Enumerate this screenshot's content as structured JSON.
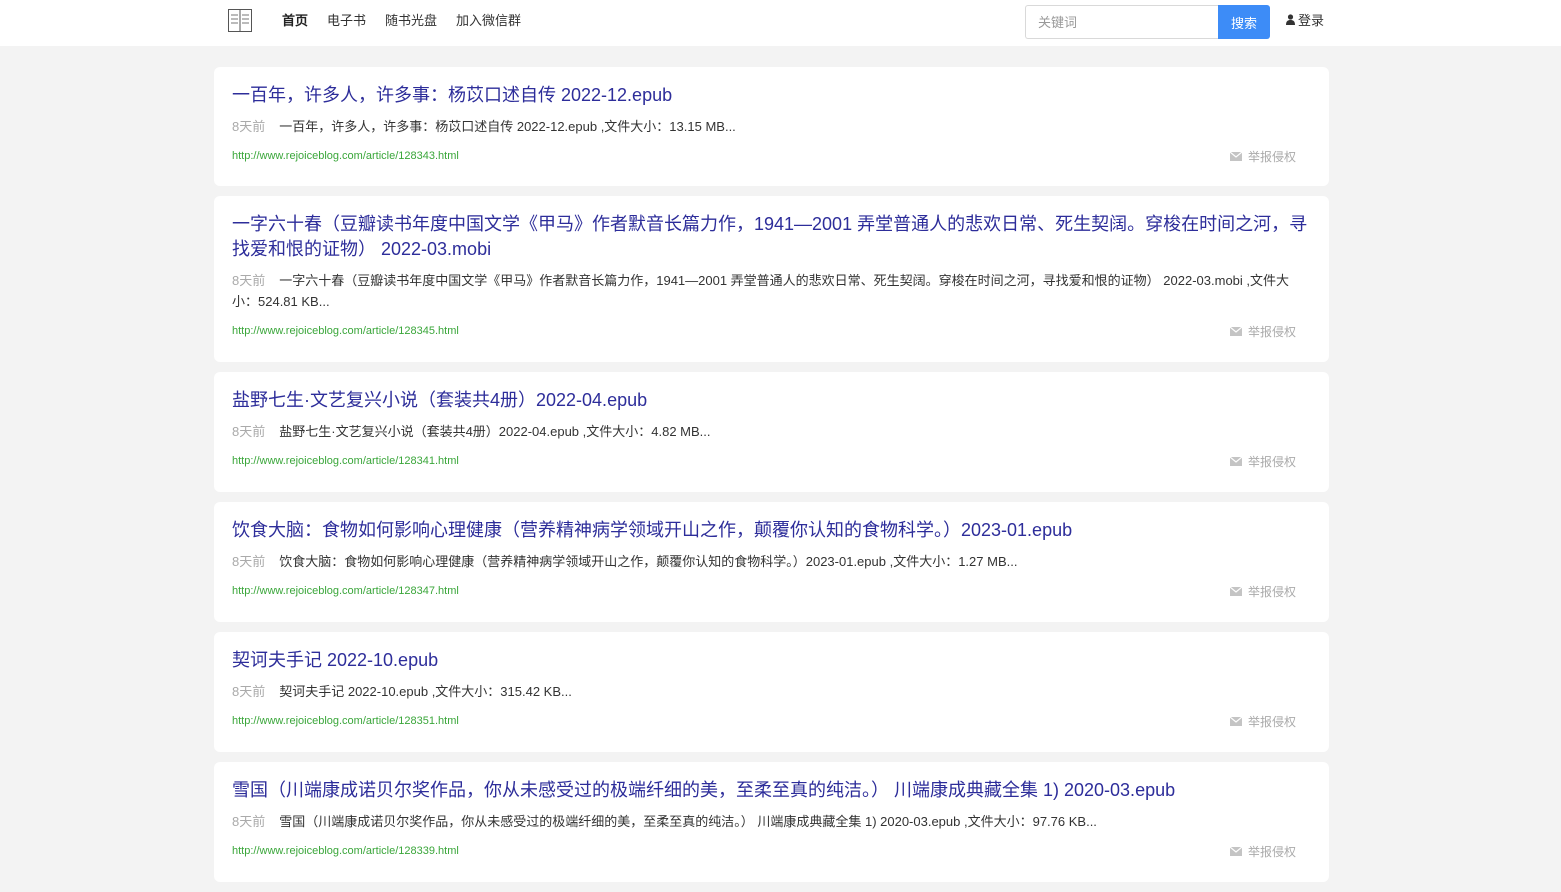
{
  "nav": {
    "items": [
      "首页",
      "电子书",
      "随书光盘",
      "加入微信群"
    ]
  },
  "search": {
    "placeholder": "关键词",
    "button": "搜索"
  },
  "login_label": "登录",
  "results": [
    {
      "title": "一百年，许多人，许多事：杨苡口述自传 2022-12.epub",
      "time": "8天前",
      "desc": "一百年，许多人，许多事：杨苡口述自传 2022-12.epub ,文件大小：13.15 MB...",
      "url": "http://www.rejoiceblog.com/article/128343.html",
      "report": "举报侵权"
    },
    {
      "title": "一字六十春（豆瓣读书年度中国文学《甲马》作者默音长篇力作，1941—2001 弄堂普通人的悲欢日常、死生契阔。穿梭在时间之河，寻找爱和恨的证物） 2022-03.mobi",
      "time": "8天前",
      "desc": "一字六十春（豆瓣读书年度中国文学《甲马》作者默音长篇力作，1941—2001 弄堂普通人的悲欢日常、死生契阔。穿梭在时间之河，寻找爱和恨的证物） 2022-03.mobi ,文件大小：524.81 KB...",
      "url": "http://www.rejoiceblog.com/article/128345.html",
      "report": "举报侵权"
    },
    {
      "title": "盐野七生·文艺复兴小说（套装共4册）2022-04.epub",
      "time": "8天前",
      "desc": "盐野七生·文艺复兴小说（套装共4册）2022-04.epub ,文件大小：4.82 MB...",
      "url": "http://www.rejoiceblog.com/article/128341.html",
      "report": "举报侵权"
    },
    {
      "title": "饮食大脑：食物如何影响心理健康（营养精神病学领域开山之作，颠覆你认知的食物科学。）2023-01.epub",
      "time": "8天前",
      "desc": "饮食大脑：食物如何影响心理健康（营养精神病学领域开山之作，颠覆你认知的食物科学。）2023-01.epub ,文件大小：1.27 MB...",
      "url": "http://www.rejoiceblog.com/article/128347.html",
      "report": "举报侵权"
    },
    {
      "title": "契诃夫手记 2022-10.epub",
      "time": "8天前",
      "desc": "契诃夫手记 2022-10.epub ,文件大小：315.42 KB...",
      "url": "http://www.rejoiceblog.com/article/128351.html",
      "report": "举报侵权"
    },
    {
      "title": "雪国（川端康成诺贝尔奖作品，你从未感受过的极端纤细的美，至柔至真的纯洁。） 川端康成典藏全集 1) 2020-03.epub",
      "time": "8天前",
      "desc": "雪国（川端康成诺贝尔奖作品，你从未感受过的极端纤细的美，至柔至真的纯洁。） 川端康成典藏全集 1) 2020-03.epub ,文件大小：97.76 KB...",
      "url": "http://www.rejoiceblog.com/article/128339.html",
      "report": "举报侵权"
    }
  ]
}
